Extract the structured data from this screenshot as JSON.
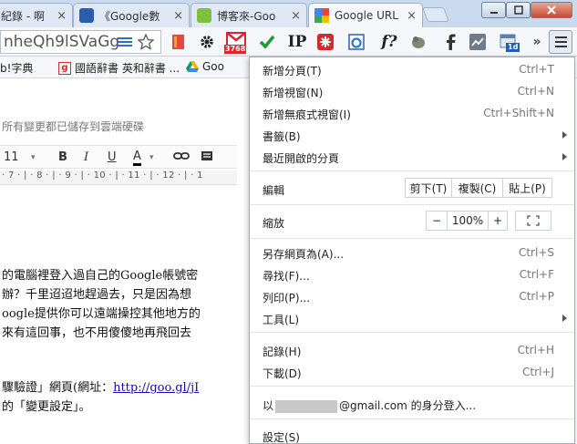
{
  "tabs": [
    {
      "label": "紀錄 - 啊",
      "close": "×"
    },
    {
      "label": "《Google數",
      "close": "×"
    },
    {
      "label": "博客來-Goo",
      "close": "×"
    },
    {
      "label": "Google URL",
      "close": "×"
    }
  ],
  "omnibox": {
    "value": "nheQh9lSVaGg"
  },
  "toolbar_icons": {
    "ip_label": "IP",
    "f_label": "f?",
    "badge_count": "3768",
    "badge2": "1d"
  },
  "bookmarks": [
    {
      "label": "b!字典"
    },
    {
      "label": "國語辭書 英和辭書 ..."
    },
    {
      "label": "Goo"
    }
  ],
  "page": {
    "save_status": "所有變更都已儲存到雲端硬碟",
    "font_size": "11",
    "ruler": "· 7 · | · 8 · | · 9 · | · 10 · | · 11 · | · 12 · | · 1",
    "lines": [
      "的電腦裡登入過自己的Google帳號密",
      "辦？千里迢迢地趕過去，只是因為想",
      "oogle提供你可以遠端操控其他地方的",
      "來有這回事，也不用傻傻地再飛回去"
    ],
    "line5_prefix": "驟驗證」網頁(網址：",
    "line5_link": "http://goo.gl/jI",
    "line6": "的「變更設定」。"
  },
  "menu": {
    "new_tab": {
      "label": "新增分頁(T)",
      "shortcut": "Ctrl+T"
    },
    "new_window": {
      "label": "新增視窗(N)",
      "shortcut": "Ctrl+N"
    },
    "incognito": {
      "label": "新增無痕式視窗(I)",
      "shortcut": "Ctrl+Shift+N"
    },
    "bookmarks": {
      "label": "書籤(B)"
    },
    "recent_tabs": {
      "label": "最近開啟的分頁"
    },
    "edit": {
      "label": "編輯",
      "cut": "剪下(T)",
      "copy": "複製(C)",
      "paste": "貼上(P)"
    },
    "zoom": {
      "label": "縮放",
      "minus": "−",
      "value": "100%",
      "plus": "+"
    },
    "save_page": {
      "label": "另存網頁為(A)...",
      "shortcut": "Ctrl+S"
    },
    "find": {
      "label": "尋找(F)...",
      "shortcut": "Ctrl+F"
    },
    "print": {
      "label": "列印(P)...",
      "shortcut": "Ctrl+P"
    },
    "tools": {
      "label": "工具(L)"
    },
    "history": {
      "label": "記錄(H)",
      "shortcut": "Ctrl+H"
    },
    "downloads": {
      "label": "下載(D)",
      "shortcut": "Ctrl+J"
    },
    "signin_prefix": "以",
    "signin_suffix": "@gmail.com 的身分登入...",
    "settings": {
      "label": "設定(S)"
    }
  },
  "colors": {
    "titlebar": "#c9d9ee",
    "menu_border": "#a7adb6",
    "link": "#1a0dab"
  }
}
